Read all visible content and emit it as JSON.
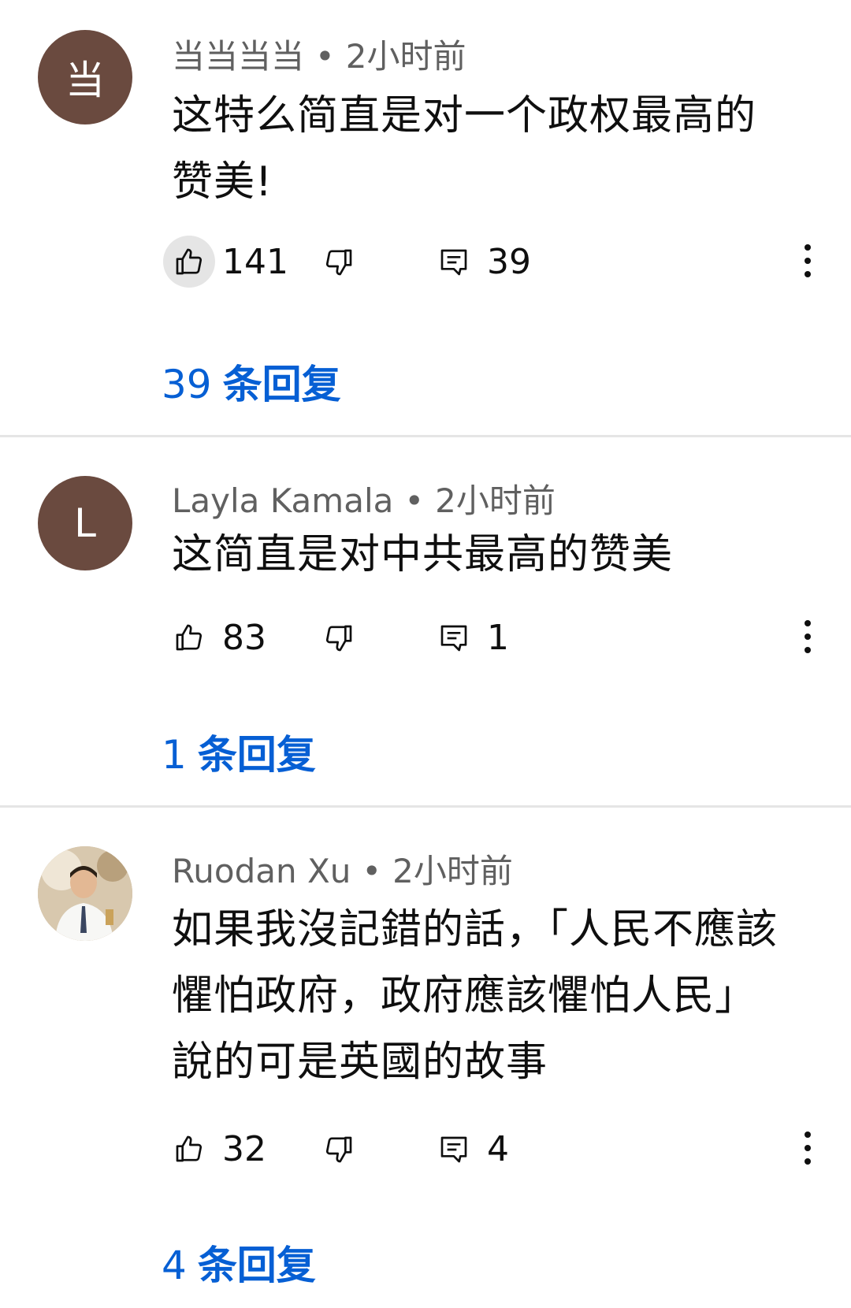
{
  "comments": [
    {
      "avatar_letter": "当",
      "avatar_color": "#6a4a3f",
      "author": "当当当当",
      "separator": "•",
      "time": "2小时前",
      "text": "这特么简直是对一个政权最高的赞美!",
      "likes": "141",
      "reply_count": "39",
      "replies_num": "39",
      "replies_label": "条回复",
      "like_active": true
    },
    {
      "avatar_letter": "L",
      "avatar_color": "#6a4a3f",
      "author": "Layla Kamala",
      "separator": "•",
      "time": "2小时前",
      "text": "这简直是对中共最高的赞美",
      "likes": "83",
      "reply_count": "1",
      "replies_num": "1",
      "replies_label": "条回复",
      "like_active": false
    },
    {
      "avatar_letter": "",
      "avatar_color": "#cdbb9f",
      "author": "Ruodan Xu",
      "separator": "•",
      "time": "2小时前",
      "text": "如果我沒記錯的話，「人民不應該懼怕政府，政府應該懼怕人民」說的可是英國的故事",
      "likes": "32",
      "reply_count": "4",
      "replies_num": "4",
      "replies_label": "条回复",
      "like_active": false
    }
  ],
  "colors": {
    "link": "#065fd4",
    "meta": "#606060",
    "divider": "#e5e5e5"
  },
  "icons": {
    "like": "thumb-up-icon",
    "dislike": "thumb-down-icon",
    "reply": "comment-icon",
    "more": "more-vert-icon"
  }
}
